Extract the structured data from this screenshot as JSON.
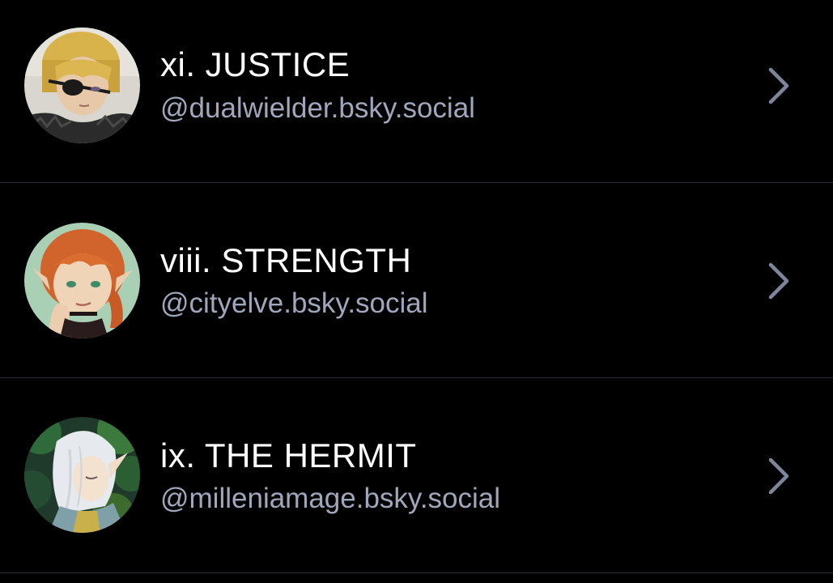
{
  "accounts": [
    {
      "name": "xi. JUSTICE",
      "handle": "@dualwielder.bsky.social",
      "avatar_icon": "avatar-blond-eyepatch",
      "chevron_icon": "chevron-right-icon"
    },
    {
      "name": "viii. STRENGTH",
      "handle": "@cityelve.bsky.social",
      "avatar_icon": "avatar-redhead-elf",
      "chevron_icon": "chevron-right-icon"
    },
    {
      "name": "ix. THE HERMIT",
      "handle": "@milleniamage.bsky.social",
      "avatar_icon": "avatar-white-haired-elf",
      "chevron_icon": "chevron-right-icon"
    }
  ],
  "colors": {
    "background": "#000000",
    "name_text": "#ffffff",
    "handle_text": "#a0a7bd",
    "divider": "#2a2d37",
    "chevron": "#7d869c"
  }
}
